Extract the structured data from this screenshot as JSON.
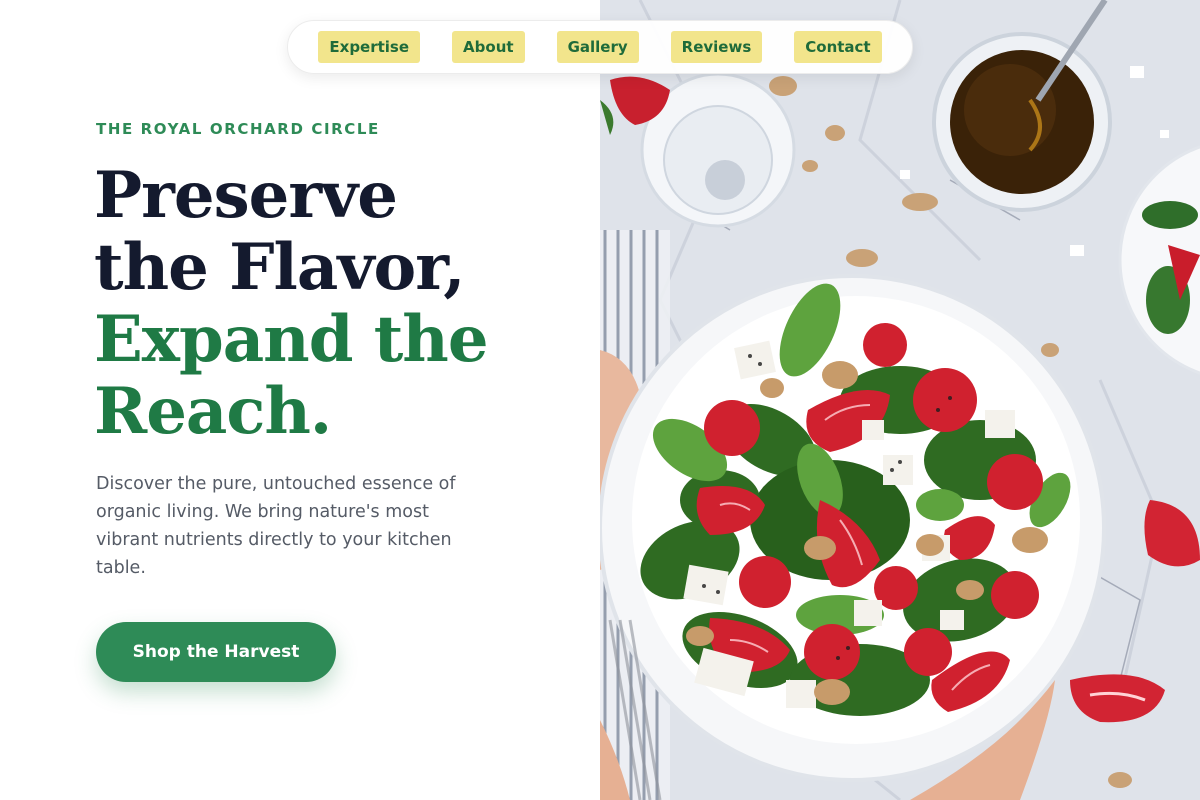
{
  "nav": {
    "items": [
      {
        "label": "Expertise"
      },
      {
        "label": "About"
      },
      {
        "label": "Gallery"
      },
      {
        "label": "Reviews"
      },
      {
        "label": "Contact"
      }
    ]
  },
  "hero": {
    "eyebrow": "THE ROYAL ORCHARD CIRCLE",
    "headline_line1": "Preserve",
    "headline_line2": "the Flavor,",
    "headline_line3": "Expand the",
    "headline_line4": "Reach.",
    "description": "Discover the pure, untouched essence of organic living. We bring nature's most vibrant nutrients directly to your kitchen table.",
    "cta_label": "Shop the Harvest"
  },
  "image": {
    "subject": "salad-bowl-photo"
  },
  "colors": {
    "brand_green": "#2e8b57",
    "headline_dark": "#141a2e",
    "headline_green": "#1f7a45",
    "nav_highlight": "#f2e58c"
  }
}
